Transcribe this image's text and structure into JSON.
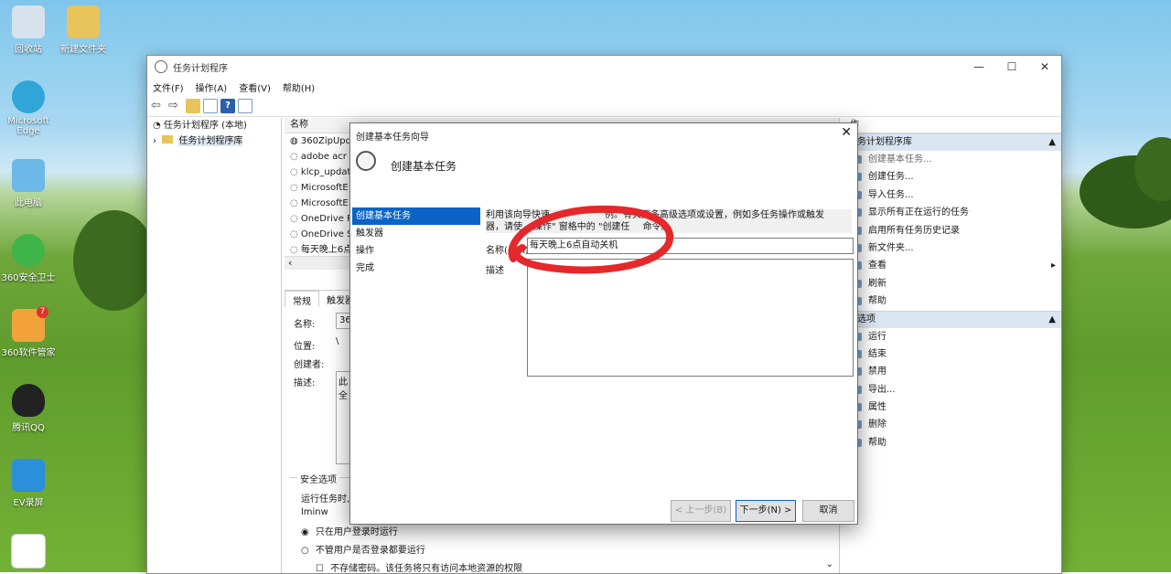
{
  "desktop": {
    "icons": [
      {
        "label": "回收站",
        "color": "#d8e2ec"
      },
      {
        "label": "新建文件夹",
        "color": "#e9c45a"
      },
      {
        "label": "Microsoft Edge",
        "color": "#2fa5d8"
      },
      {
        "label": "此电脑",
        "color": "#6cb8e8"
      },
      {
        "label": "360安全卫士",
        "color": "#3fb449"
      },
      {
        "label": "360软件管家",
        "color": "#f1a23a"
      },
      {
        "label": "腾讯QQ",
        "color": "#222222"
      },
      {
        "label": "EV录屏",
        "color": "#2c8fdc"
      }
    ],
    "badge": "7"
  },
  "window": {
    "title": "任务计划程序",
    "menu": [
      "文件(F)",
      "操作(A)",
      "查看(V)",
      "帮助(H)"
    ],
    "tree": [
      "任务计划程序 (本地)",
      "任务计划程序库"
    ],
    "list_header": "名称",
    "tasks": [
      "360ZipUpd",
      "adobe acr",
      "klcp_updat",
      "MicrosoftE",
      "MicrosoftE",
      "OneDrive R",
      "OneDrive S",
      "每天晚上6点"
    ],
    "tabs": [
      "常规",
      "触发器"
    ],
    "props": {
      "name_label": "名称:",
      "name_value": "36",
      "location_label": "位置:",
      "location_value": "\\",
      "author_label": "创建者:",
      "desc_label": "描述:",
      "desc_value_1": "此",
      "desc_value_2": "全"
    },
    "security": {
      "title": "安全选项",
      "run_as_label": "运行任务时,",
      "user": "lminw",
      "opt1": "只在用户登录时运行",
      "opt2": "不管用户是否登录都要运行",
      "opt3": "不存储密码。该任务将只有访问本地资源的权限"
    },
    "actions_title": "作",
    "sections": [
      {
        "title": "务计划程序库",
        "items": [
          "创建基本任务...",
          "创建任务...",
          "导入任务...",
          "显示所有正在运行的任务",
          "启用所有任务历史记录",
          "新文件夹...",
          "查看",
          "刷新",
          "帮助"
        ]
      },
      {
        "title": "选项",
        "items": [
          "运行",
          "结束",
          "禁用",
          "导出...",
          "属性",
          "删除",
          "帮助"
        ]
      }
    ]
  },
  "dialog": {
    "title": "创建基本任务向导",
    "header": "创建基本任务",
    "steps": [
      "创建基本任务",
      "触发器",
      "操作",
      "完成"
    ],
    "intro_1": "利用该向导快速",
    "intro_1b": "例。有关更多高级选项或设置，例如多任务操作或触发",
    "intro_2a": "器，请使",
    "intro_2b": "操作\" 窗格中的 \"创建任",
    "intro_2c": "命令。",
    "name_label": "名称(",
    "name_label_b": "A):",
    "name_value": "每天晚上6点自动关机",
    "desc_label": "描述",
    "btn_back": "< 上一步(B)",
    "btn_next": "下一步(N) >",
    "btn_cancel": "取消"
  }
}
